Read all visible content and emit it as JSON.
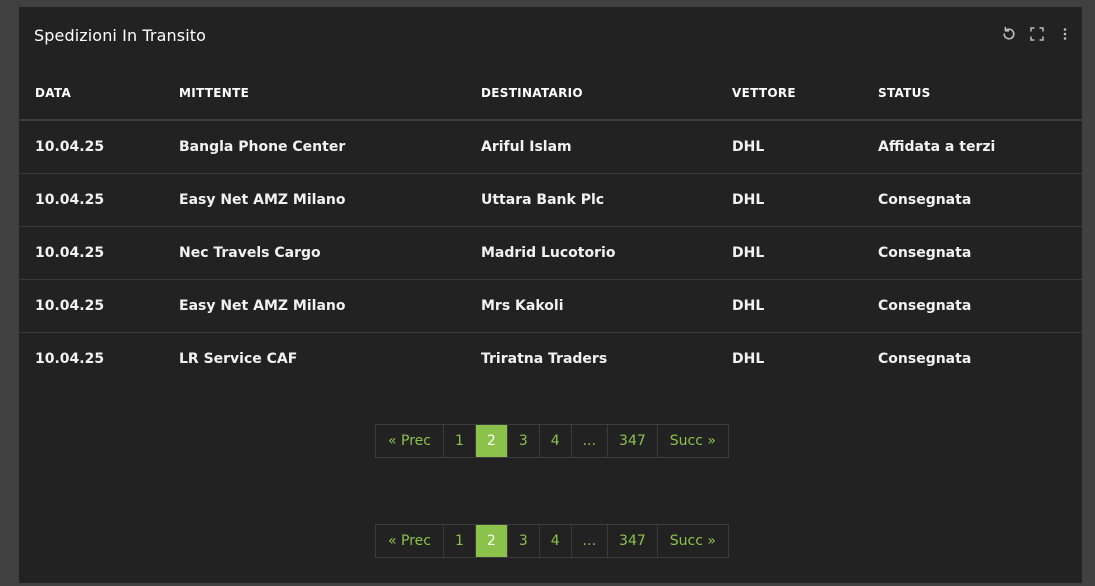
{
  "card": {
    "title": "Spedizioni In Transito"
  },
  "toolbar": {
    "icons": [
      "refresh-icon",
      "fullscreen-icon",
      "more-vertical-icon"
    ]
  },
  "table": {
    "headers": [
      "DATA",
      "MITTENTE",
      "DESTINATARIO",
      "VETTORE",
      "STATUS"
    ],
    "rows": [
      [
        "10.04.25",
        "Bangla Phone Center",
        "Ariful Islam",
        "DHL",
        "Affidata a terzi"
      ],
      [
        "10.04.25",
        "Easy Net AMZ Milano",
        "Uttara Bank Plc",
        "DHL",
        "Consegnata"
      ],
      [
        "10.04.25",
        "Nec Travels Cargo",
        "Madrid Lucotorio",
        "DHL",
        "Consegnata"
      ],
      [
        "10.04.25",
        "Easy Net AMZ Milano",
        "Mrs Kakoli",
        "DHL",
        "Consegnata"
      ],
      [
        "10.04.25",
        "LR Service CAF",
        "Triratna Traders",
        "DHL",
        "Consegnata"
      ]
    ]
  },
  "pagination": {
    "prev": "« Prec",
    "pages": [
      "1",
      "2",
      "3",
      "4",
      "...",
      "347"
    ],
    "active": "2",
    "next": "Succ »"
  },
  "colors": {
    "accent": "#8bc34a",
    "card_bg": "#222222",
    "frame_bg": "#404040"
  }
}
